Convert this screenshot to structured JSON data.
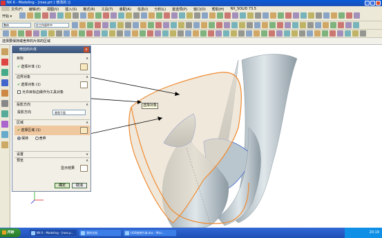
{
  "window": {
    "title": "NX 6 - Modeling - [rose.prt ( 修改的 )]"
  },
  "menu": [
    "文件(F)",
    "编辑(E)",
    "视图(V)",
    "插入(S)",
    "格式(R)",
    "工具(T)",
    "装配(A)",
    "信息(I)",
    "分析(L)",
    "首选项(P)",
    "窗口(O)",
    "帮助(H)",
    "NX_SOLID 73.5"
  ],
  "toolbar": {
    "start_label": "开始 ▾",
    "filter_value": "整体",
    "snap_value": "在工作部件中"
  },
  "status_prompt": "选择要保持或舍弃的片体的区域",
  "dialog": {
    "title": "修剪的片体",
    "sections": {
      "target": {
        "label": "目标",
        "row": "选择片体 (1)"
      },
      "boundary": {
        "label": "边界对象",
        "row": "选择对象 (1)",
        "checkbox": "允许目标边缘作为工具对象"
      },
      "projection": {
        "label": "投影方向",
        "field_label": "投影方向",
        "value": "垂直于面"
      },
      "region": {
        "label": "区域",
        "row": "选择区域 (1)",
        "keep": "保持",
        "discard": "舍弃"
      },
      "settings": {
        "label": "设置"
      },
      "preview": {
        "label": "预览",
        "button": "显示结果"
      }
    },
    "ok": "确定",
    "cancel": "取消"
  },
  "viewport": {
    "tooltip": "选择对象"
  },
  "taskbar": {
    "start": "开始",
    "tasks": [
      "NX 6 - Modeling - [rose.p...",
      "我的文档",
      "UG6修剪片体.doc - Micr..."
    ],
    "clock": "20:19"
  }
}
